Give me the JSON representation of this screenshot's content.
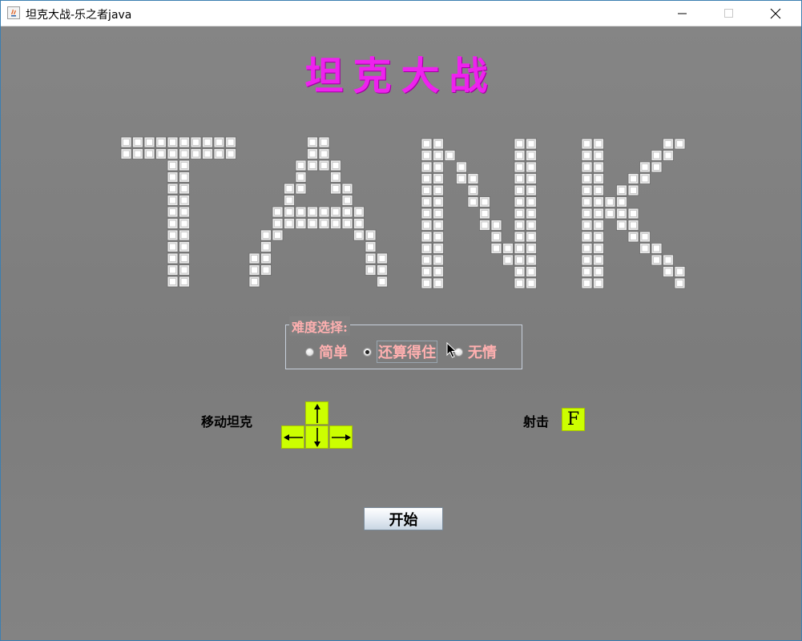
{
  "window": {
    "title": "坦克大战-乐之者java",
    "controls": [
      "minimize",
      "maximize",
      "close"
    ]
  },
  "game": {
    "title": "坦克大战",
    "banner_text": "TANK",
    "title_color": "#ee22ee"
  },
  "difficulty": {
    "legend": "难度选择:",
    "options": [
      {
        "label": "简单",
        "checked": false
      },
      {
        "label": "还算得住",
        "checked": true
      },
      {
        "label": "无情",
        "checked": false
      }
    ],
    "label_color": "#ffb0b0"
  },
  "controls_help": {
    "move_label": "移动坦克",
    "shoot_label": "射击",
    "shoot_key": "F",
    "arrow_keys": [
      "arrow-up-icon",
      "arrow-left-icon",
      "arrow-down-icon",
      "arrow-right-icon"
    ],
    "key_color": "#ccff00"
  },
  "start_button": {
    "label": "开始"
  }
}
